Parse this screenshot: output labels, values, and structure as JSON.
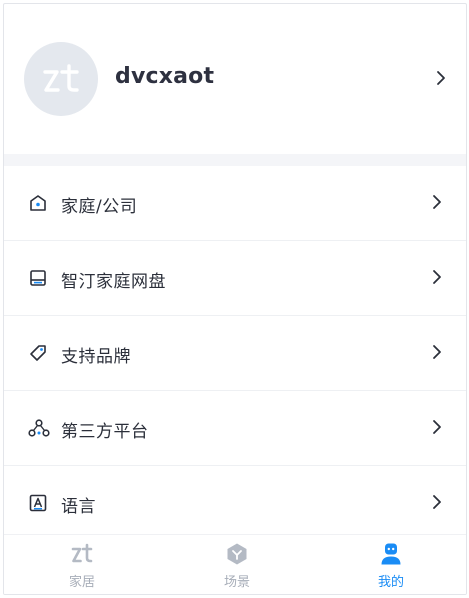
{
  "profile": {
    "username": "dvcxaot",
    "avatar_icon": "zt-logo-icon"
  },
  "menu": {
    "items": [
      {
        "id": "home-company",
        "label": "家庭/公司",
        "icon": "home-icon"
      },
      {
        "id": "cloud-drive",
        "label": "智汀家庭网盘",
        "icon": "drive-icon"
      },
      {
        "id": "brands",
        "label": "支持品牌",
        "icon": "tag-icon"
      },
      {
        "id": "third-party",
        "label": "第三方平台",
        "icon": "network-icon"
      },
      {
        "id": "language",
        "label": "语言",
        "icon": "language-icon"
      }
    ]
  },
  "tabbar": {
    "tabs": [
      {
        "id": "home",
        "label": "家居",
        "active": false
      },
      {
        "id": "scenes",
        "label": "场景",
        "active": false
      },
      {
        "id": "mine",
        "label": "我的",
        "active": true
      }
    ]
  },
  "colors": {
    "accent": "#1a8cf5",
    "inactive": "#a7adb8",
    "text": "#2b2f3a",
    "separator": "#f4f5f8",
    "avatar_bg": "#e4e8ee"
  }
}
